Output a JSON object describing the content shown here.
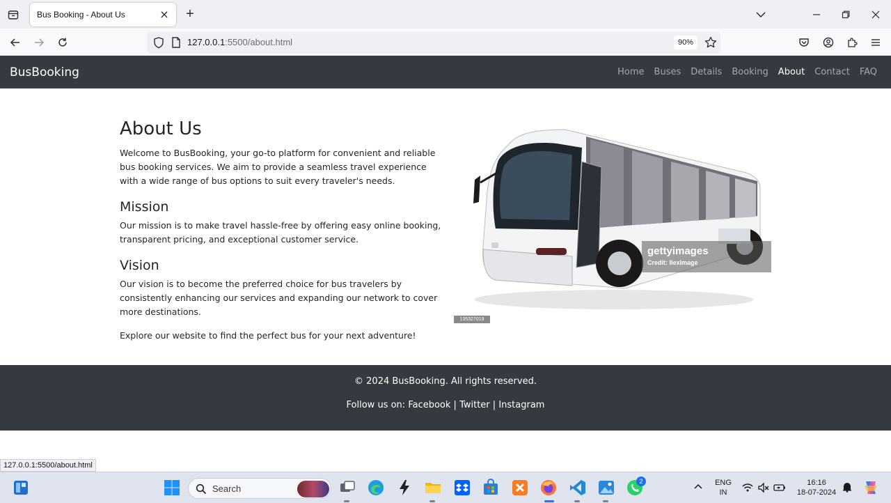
{
  "browser": {
    "tab_title": "Bus Booking - About Us",
    "url_host": "127.0.0.1",
    "url_rest": ":5500/about.html",
    "zoom": "90%",
    "status_url": "127.0.0.1:5500/about.html"
  },
  "site": {
    "brand": "BusBooking",
    "nav": [
      {
        "label": "Home",
        "active": false
      },
      {
        "label": "Buses",
        "active": false
      },
      {
        "label": "Details",
        "active": false
      },
      {
        "label": "Booking",
        "active": false
      },
      {
        "label": "About",
        "active": true
      },
      {
        "label": "Contact",
        "active": false
      },
      {
        "label": "FAQ",
        "active": false
      }
    ]
  },
  "content": {
    "title": "About Us",
    "intro": "Welcome to BusBooking, your go-to platform for convenient and reliable bus booking services. We aim to provide a seamless travel experience with a wide range of bus options to suit every traveler's needs.",
    "mission_heading": "Mission",
    "mission_text": "Our mission is to make travel hassle-free by offering easy online booking, transparent pricing, and exceptional customer service.",
    "vision_heading": "Vision",
    "vision_text": "Our vision is to become the preferred choice for bus travelers by consistently enhancing our services and expanding our network to cover more destinations.",
    "explore": "Explore our website to find the perfect bus for your next adventure!",
    "image": {
      "watermark": "gettyimages",
      "credit": "Credit: IlexImage",
      "stock_id": "135327019"
    }
  },
  "footer": {
    "copyright": "© 2024 BusBooking. All rights reserved.",
    "follow_prefix": "Follow us on:",
    "links": [
      "Facebook",
      "Twitter",
      "Instagram"
    ],
    "separator": "|"
  },
  "taskbar": {
    "search_placeholder": "Search",
    "lang_top": "ENG",
    "lang_bottom": "IN",
    "time": "16:16",
    "date": "18-07-2024",
    "whatsapp_badge": "2"
  }
}
